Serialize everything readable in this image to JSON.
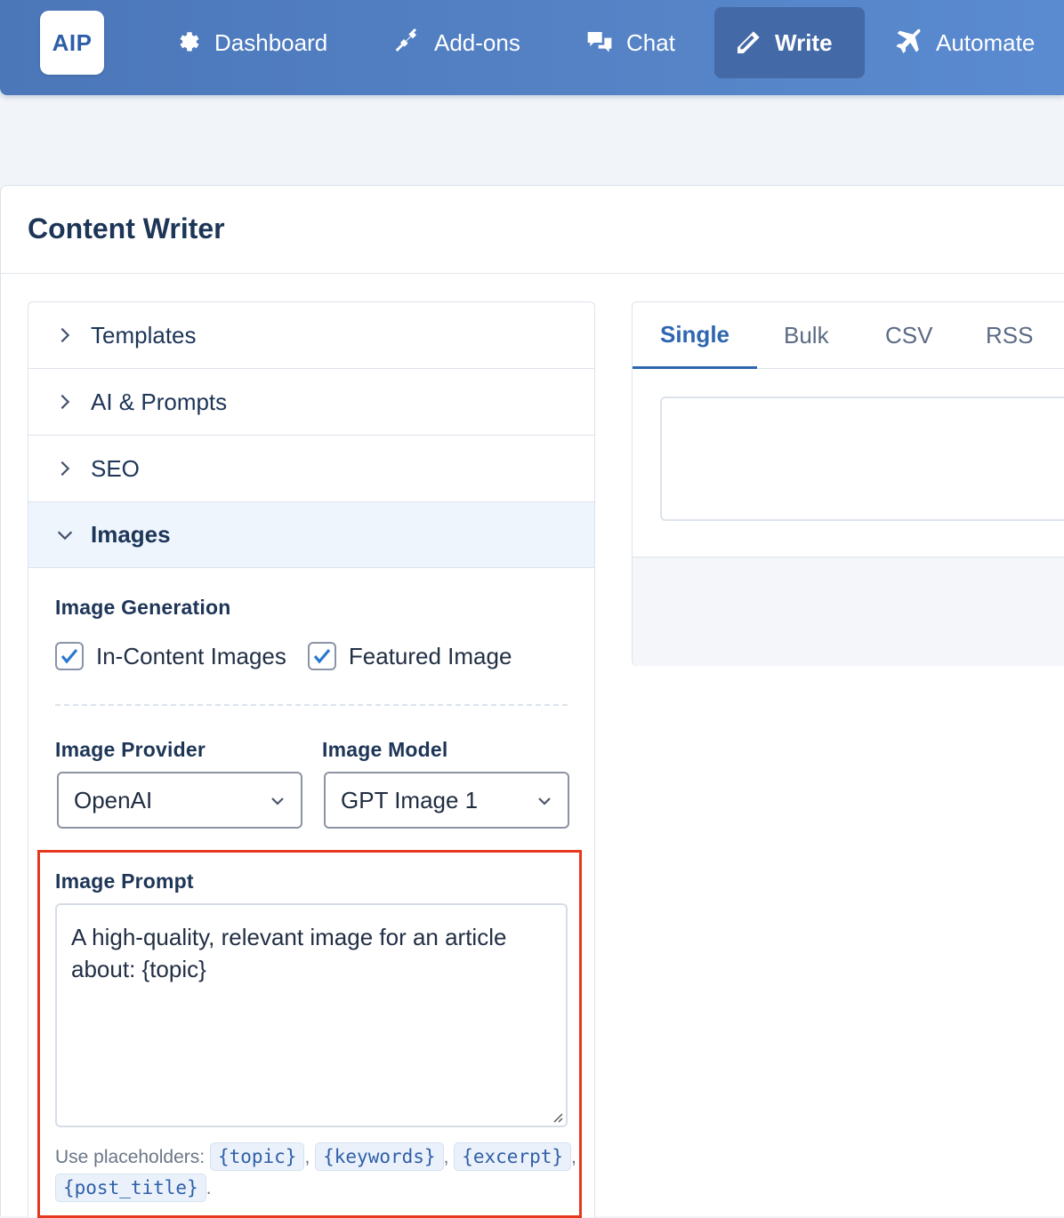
{
  "nav": {
    "logo": "AIP",
    "items": [
      {
        "label": "Dashboard",
        "icon": "gear-icon"
      },
      {
        "label": "Add-ons",
        "icon": "plug-icon"
      },
      {
        "label": "Chat",
        "icon": "chat-bubbles-icon"
      },
      {
        "label": "Write",
        "icon": "pencil-icon",
        "active": true
      },
      {
        "label": "Automate",
        "icon": "plane-icon"
      }
    ]
  },
  "page": {
    "title": "Content Writer"
  },
  "accordion": {
    "sections": [
      {
        "label": "Templates",
        "open": false
      },
      {
        "label": "AI & Prompts",
        "open": false
      },
      {
        "label": "SEO",
        "open": false
      },
      {
        "label": "Images",
        "open": true
      }
    ]
  },
  "images": {
    "generation_label": "Image Generation",
    "in_content": {
      "label": "In-Content Images",
      "checked": true
    },
    "featured": {
      "label": "Featured Image",
      "checked": true
    },
    "provider_label": "Image Provider",
    "provider_value": "OpenAI",
    "model_label": "Image Model",
    "model_value": "GPT Image 1",
    "prompt_label": "Image Prompt",
    "prompt_value": "A high-quality, relevant image for an article about: {topic}",
    "hint_prefix": "Use placeholders:",
    "placeholders": [
      "{topic}",
      "{keywords}",
      "{excerpt}",
      "{post_title}"
    ]
  },
  "right_panel": {
    "tabs": [
      {
        "label": "Single",
        "active": true
      },
      {
        "label": "Bulk"
      },
      {
        "label": "CSV"
      },
      {
        "label": "RSS"
      }
    ]
  },
  "colors": {
    "nav_bg": "#5583c6",
    "accent": "#2f66b0",
    "highlight_border": "#e6381f"
  }
}
